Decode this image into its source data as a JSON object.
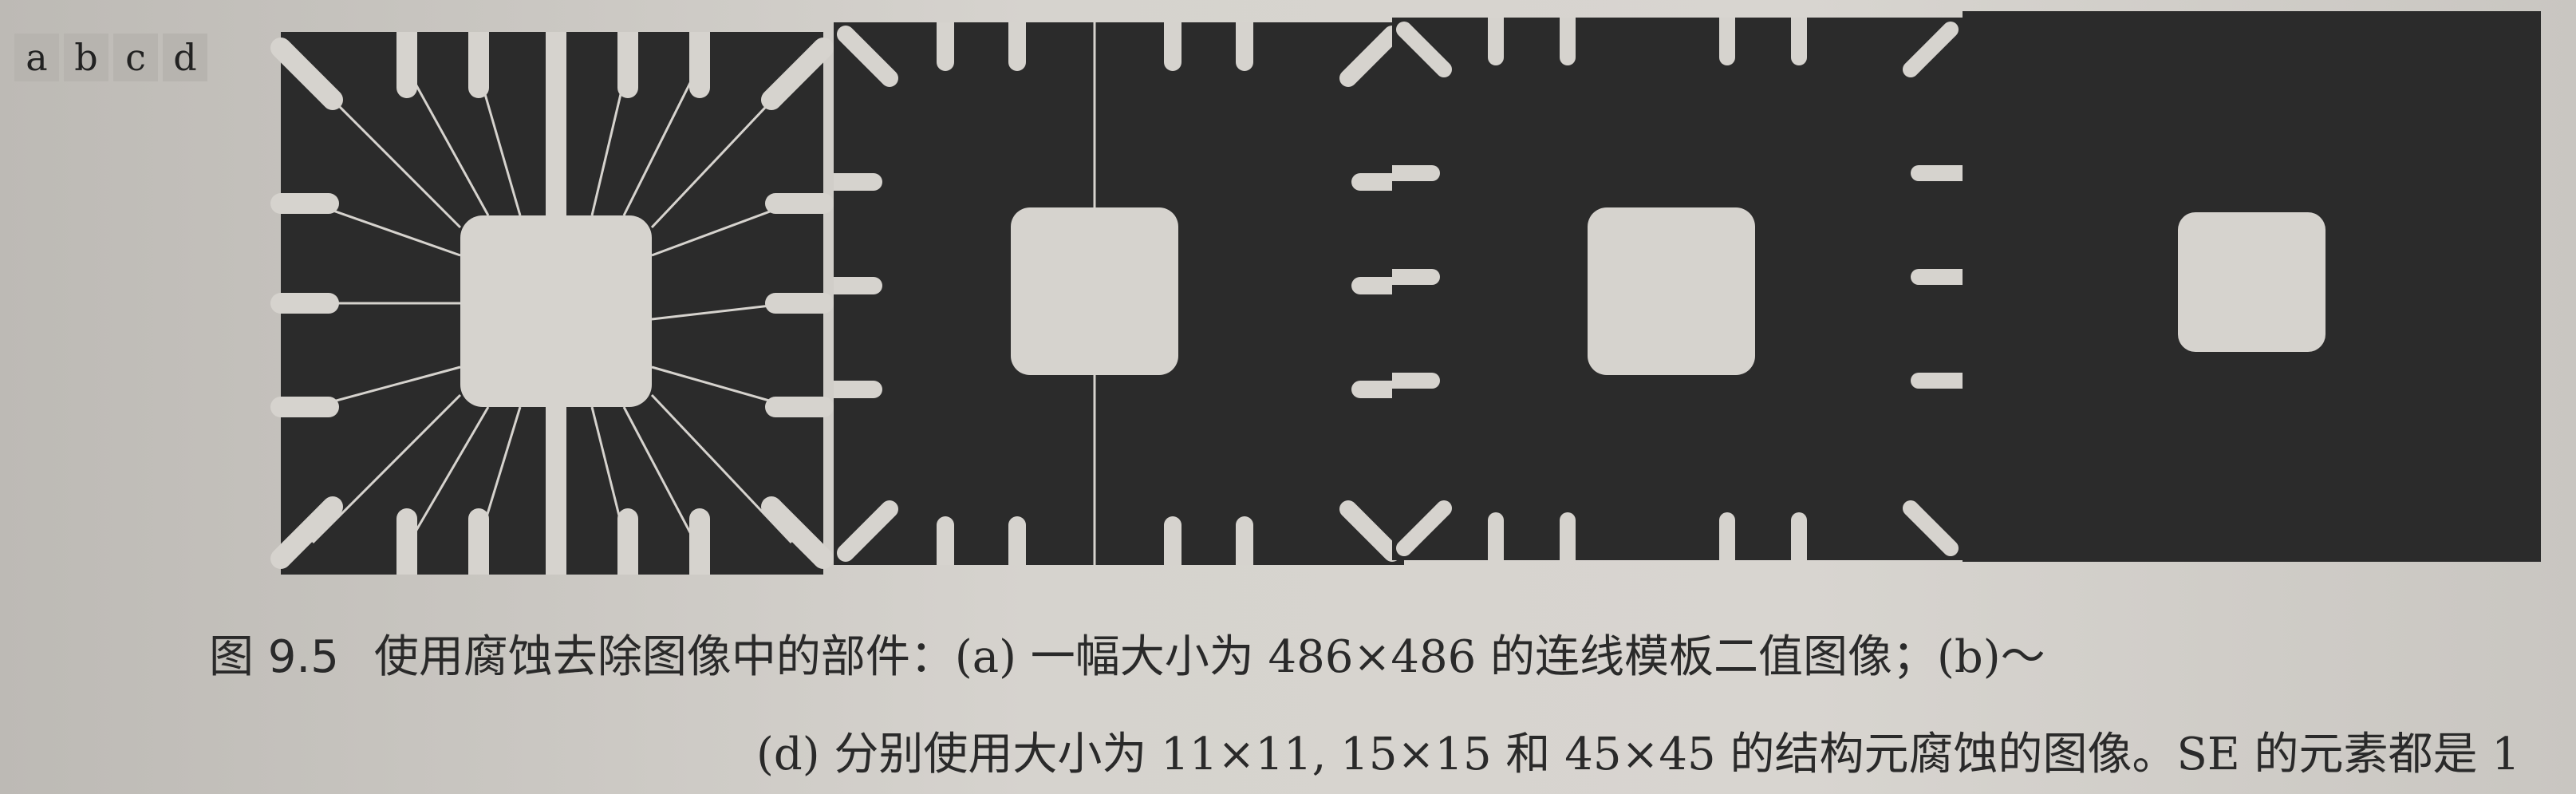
{
  "panels": {
    "labels": [
      "a",
      "b",
      "c",
      "d"
    ]
  },
  "caption": {
    "figure_number": "图 9.5",
    "line1": "使用腐蚀去除图像中的部件：(a) 一幅大小为 486×486 的连线模板二值图像；(b)～",
    "line2": "(d) 分别使用大小为 11×11, 15×15 和 45×45 的结构元腐蚀的图像。SE 的元素都是 1"
  },
  "colors": {
    "ink": "#2b2b2b",
    "paper": "#d6d3ce",
    "label_bg": "#b7b4af"
  }
}
